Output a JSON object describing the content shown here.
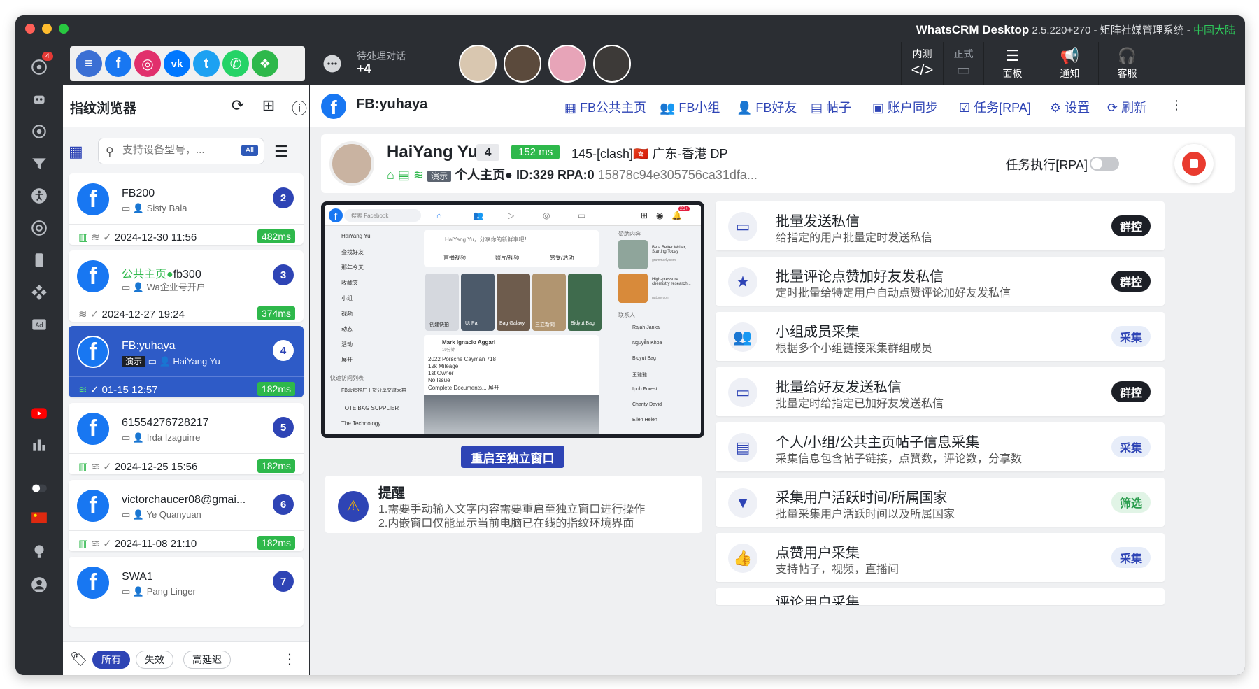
{
  "window": {
    "app_name": "WhatsCRM Desktop",
    "version": "2.5.220+270",
    "subtitle": " - 矩阵社媒管理系统 - ",
    "region": "中国大陆"
  },
  "rail": {
    "badge": "4"
  },
  "topbar": {
    "pending_label": "待处理对话",
    "pending_count": "+4",
    "buttons": [
      {
        "label": "内测",
        "icon": "code-icon"
      },
      {
        "label": "正式",
        "icon": "monitor-icon"
      },
      {
        "label": "面板",
        "icon": "sliders-icon"
      },
      {
        "label": "通知",
        "icon": "megaphone-icon"
      },
      {
        "label": "客服",
        "icon": "headset-icon"
      }
    ]
  },
  "left_panel": {
    "title": "指纹浏览器",
    "search_placeholder": "支持设备型号，...",
    "search_tag": "All",
    "accounts": [
      {
        "name": "FB200",
        "sub": "Sisty Bala",
        "num": "2",
        "date": "2024-12-30 11:56",
        "latency": "482ms"
      },
      {
        "name_prefix": "公共主页",
        "name": "fb300",
        "sub": "Wa企业号开户",
        "num": "3",
        "date": "2024-12-27 19:24",
        "latency": "374ms"
      },
      {
        "name": "FB:yuhaya",
        "tag": "演示",
        "sub": "HaiYang Yu",
        "num": "4",
        "date": "01-15 12:57",
        "latency": "182ms"
      },
      {
        "name": "61554276728217",
        "sub": "Irda Izaguirre",
        "num": "5",
        "date": "2024-12-25 15:56",
        "latency": "182ms"
      },
      {
        "name": "victorchaucer08@gmai...",
        "sub": "Ye Quanyuan",
        "num": "6",
        "date": "2024-11-08 21:10",
        "latency": "182ms"
      },
      {
        "name": "SWA1",
        "sub": "Pang Linger",
        "num": "7"
      }
    ],
    "filters": [
      "所有",
      "失效",
      "高延迟"
    ]
  },
  "main": {
    "title": "FB:yuhaya",
    "nav": [
      "FB公共主页",
      "FB小组",
      "FB好友",
      "帖子",
      "账户同步",
      "任务[RPA]",
      "设置",
      "刷新"
    ],
    "profile": {
      "name": "HaiYang Yu",
      "count": "4",
      "ping": "152 ms",
      "ip": "145-[clash]🇭🇰 广东-香港 DP",
      "tag": "演示",
      "page_type": "个人主页●",
      "id": "ID:329",
      "rpa": "RPA:0",
      "hash": "15878c94e305756ca31dfa...",
      "rpa_label": "任务执行[RPA]"
    },
    "browser": {
      "search": "搜索 Facebook",
      "user": "HaiYang Yu",
      "composer": "HaiYang Yu，分享你的新鲜事吧！",
      "left_menu": [
        "HaiYang Yu",
        "查找好友",
        "那年今天",
        "收藏夹",
        "小组",
        "视频",
        "动态",
        "活动",
        "展开"
      ],
      "shortcuts_title": "快速访问列表",
      "shortcuts": [
        "FB营销推广干货分享交流大群",
        "TOTE BAG SUPPLIER",
        "The Technology"
      ],
      "stories": [
        "创建快拍",
        "Ut Pai",
        "Bag Galaxy",
        "三立新聞",
        "Bidyut Bag"
      ],
      "post_author": "Mark Ignacio Aggari",
      "post_time": "19分钟 · ",
      "post_lines": [
        "2022 Porsche Cayman 718",
        "12k Mileage",
        "1st Owner",
        "No Issue",
        "Complete Documents... 展开"
      ],
      "sponsored_title": "赞助内容",
      "ads": [
        "Be a Better Writer, Starting Today",
        "High-pressure chemistry research..."
      ],
      "ad_sources": [
        "grammarly.com",
        "nature.com"
      ],
      "contacts_title": "联系人",
      "contacts": [
        "Rajah Janka",
        "Nguyễn Khoa",
        "Bidyut Bag",
        "王雅雅",
        "Ipoh Forest",
        "Charity David",
        "Ellen Helen"
      ],
      "composer_actions": [
        "直播视频",
        "照片/视频",
        "感受/活动"
      ],
      "notif_badge": "20+"
    },
    "restart_button": "重启至独立窗口",
    "reminder": {
      "title": "提醒",
      "line1": "1.需要手动输入文字内容需要重启至独立窗口进行操作",
      "line2": "2.内嵌窗口仅能显示当前电脑已在线的指纹环境界面"
    },
    "tasks": [
      {
        "title": "批量发送私信",
        "desc": "给指定的用户批量定时发送私信",
        "btn": "群控",
        "style": "dark"
      },
      {
        "title": "批量评论点赞加好友发私信",
        "desc": "定时批量给特定用户自动点赞评论加好友发私信",
        "btn": "群控",
        "style": "dark"
      },
      {
        "title": "小组成员采集",
        "desc": "根据多个小组链接采集群组成员",
        "btn": "采集",
        "style": "light"
      },
      {
        "title": "批量给好友发送私信",
        "desc": "批量定时给指定已加好友发送私信",
        "btn": "群控",
        "style": "dark"
      },
      {
        "title": "个人/小组/公共主页帖子信息采集",
        "desc": "采集信息包含帖子链接，点赞数，评论数，分享数",
        "btn": "采集",
        "style": "light"
      },
      {
        "title": "采集用户活跃时间/所属国家",
        "desc": "批量采集用户活跃时间以及所属国家",
        "btn": "筛选",
        "style": "green"
      },
      {
        "title": "点赞用户采集",
        "desc": "支持帖子，视频，直播间",
        "btn": "采集",
        "style": "light"
      },
      {
        "title": "评论用户采集",
        "desc": "",
        "btn": "",
        "style": "light"
      }
    ]
  }
}
